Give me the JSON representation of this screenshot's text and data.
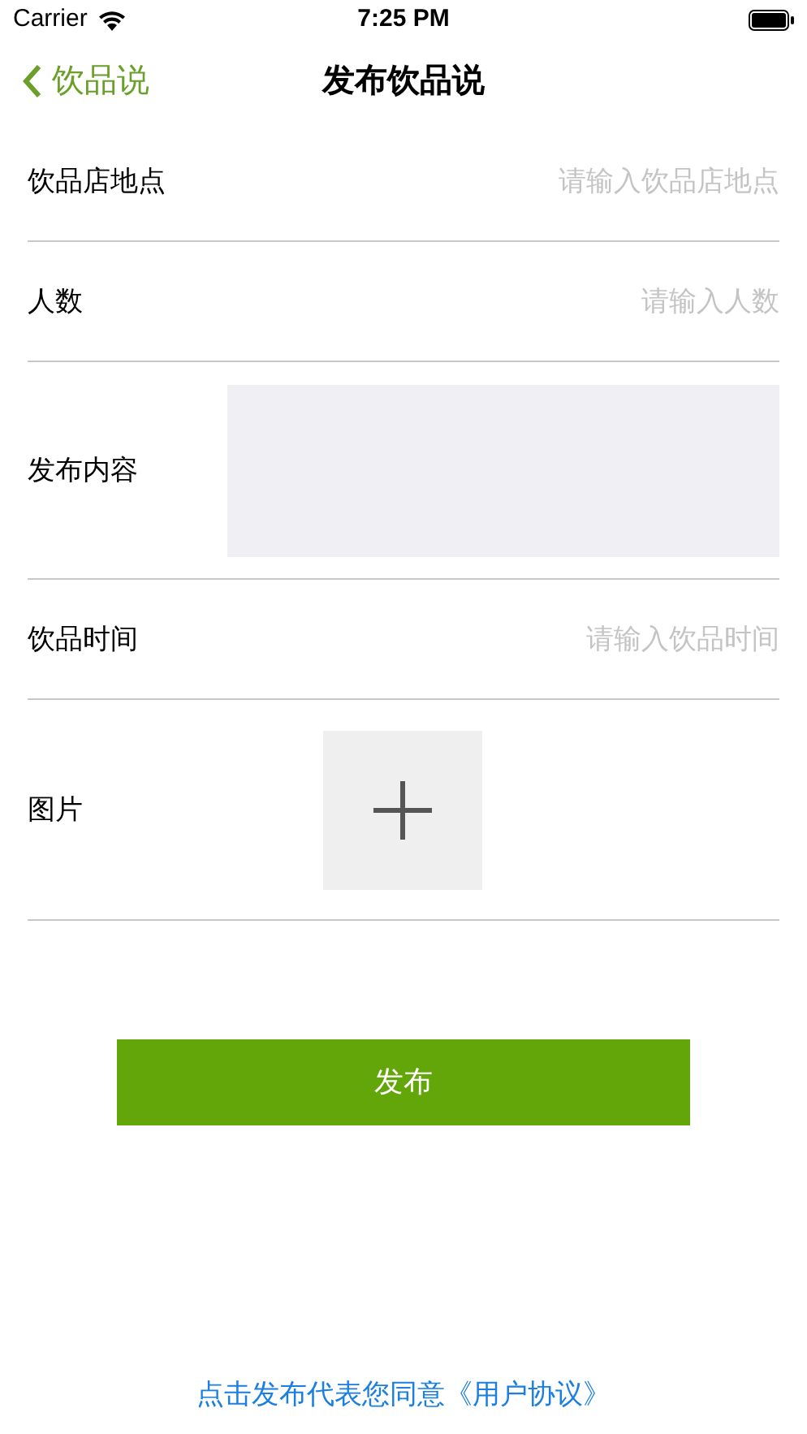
{
  "status_bar": {
    "carrier": "Carrier",
    "time": "7:25 PM"
  },
  "nav": {
    "back_label": "饮品说",
    "title": "发布饮品说"
  },
  "form": [
    {
      "kind": "input",
      "label": "饮品店地点",
      "placeholder": "请输入饮品店地点"
    },
    {
      "kind": "input",
      "label": "人数",
      "placeholder": "请输入人数"
    },
    {
      "kind": "textarea",
      "label": "发布内容"
    },
    {
      "kind": "input",
      "label": "饮品时间",
      "placeholder": "请输入饮品时间"
    },
    {
      "kind": "image",
      "label": "图片"
    }
  ],
  "submit_button": "发布",
  "agreement_link": "点击发布代表您同意《用户协议》"
}
